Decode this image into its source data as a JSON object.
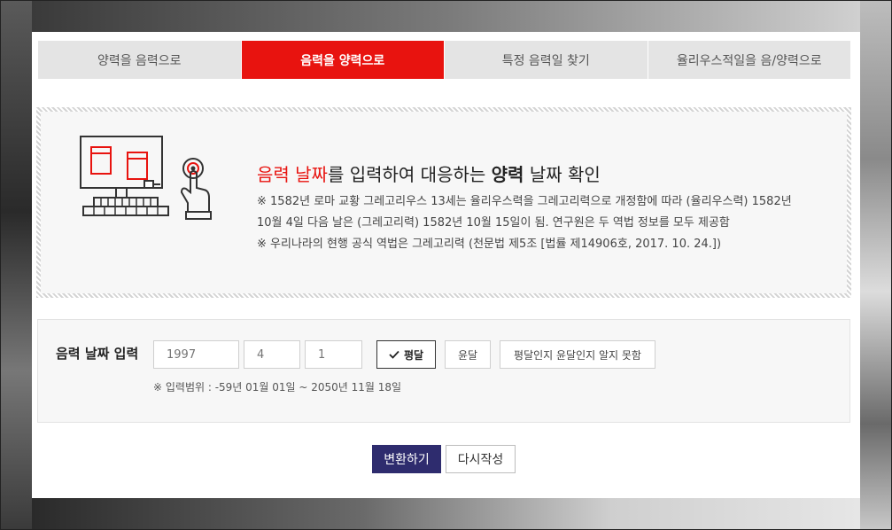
{
  "tabs": [
    {
      "label": "양력을 음력으로",
      "active": false
    },
    {
      "label": "음력을 양력으로",
      "active": true
    },
    {
      "label": "특정 음력일 찾기",
      "active": false
    },
    {
      "label": "율리우스적일을 음/양력으로",
      "active": false
    }
  ],
  "info": {
    "title_red": "음력 날짜",
    "title_mid": "를 입력하여 대응하는 ",
    "title_bold": "양력",
    "title_end": " 날짜 확인",
    "note_line1": "※ 1582년 로마 교황 그레고리우스 13세는 율리우스력을 그레고리력으로 개정함에 따라 (율리우스력) 1582년",
    "note_line2": "10월 4일 다음 날은 (그레고리력) 1582년 10월 15일이 됨. 연구원은 두 역법 정보를 모두 제공함",
    "note_line3": "※ 우리나라의 현행 공식 역법은 그레고리력 (천문법 제5조 [법률 제14906호, 2017. 10. 24.])"
  },
  "form": {
    "label": "음력 날짜 입력",
    "year_placeholder": "1997",
    "month_placeholder": "4",
    "day_placeholder": "1",
    "options": [
      {
        "label": "평달",
        "selected": true
      },
      {
        "label": "윤달",
        "selected": false
      },
      {
        "label": "평달인지 윤달인지 알지 못함",
        "selected": false
      }
    ],
    "range_note": "※ 입력범위 : -59년 01월 01일 ~ 2050년 11월 18일"
  },
  "buttons": {
    "convert": "변환하기",
    "reset": "다시작성"
  },
  "colors": {
    "accent_red": "#e8130f",
    "convert_navy": "#2e2c6e"
  },
  "icons": {
    "illustration": "computer-touch-icon",
    "check": "check-icon"
  }
}
